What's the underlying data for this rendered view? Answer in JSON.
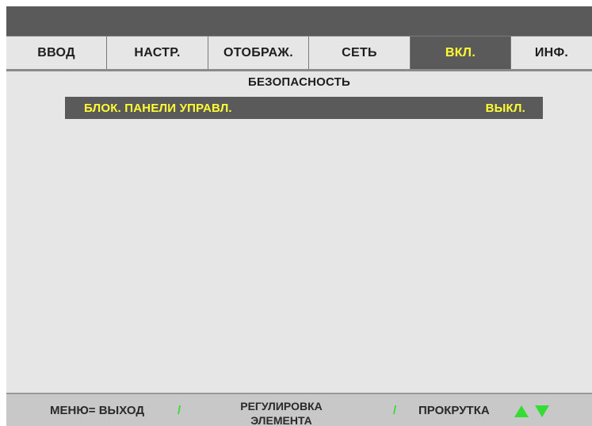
{
  "tabs": [
    {
      "label": "ВВОД",
      "active": false
    },
    {
      "label": "НАСТР.",
      "active": false
    },
    {
      "label": "ОТОБРАЖ.",
      "active": false
    },
    {
      "label": "СЕТЬ",
      "active": false
    },
    {
      "label": "ВКЛ.",
      "active": true
    },
    {
      "label": "ИНФ.",
      "active": false
    }
  ],
  "section": {
    "title": "БЕЗОПАСНОСТЬ"
  },
  "menu": {
    "items": [
      {
        "label": "БЛОК. ПАНЕЛИ УПРАВЛ.",
        "value": "ВЫКЛ.",
        "selected": true
      }
    ]
  },
  "footer": {
    "menu_exit": "МЕНЮ= ВЫХОД",
    "separator": "/",
    "adjust_line1": "РЕГУЛИРОВКА",
    "adjust_line2": "ЭЛЕМЕНТА",
    "scroll": "ПРОКРУТКА",
    "scroll_icons": [
      "arrow-up-icon",
      "arrow-down-icon"
    ]
  },
  "colors": {
    "highlight_text": "#ffff33",
    "highlight_bg": "#5a5a5a",
    "panel_bg": "#e6e6e6",
    "arrow": "#33dd33"
  }
}
